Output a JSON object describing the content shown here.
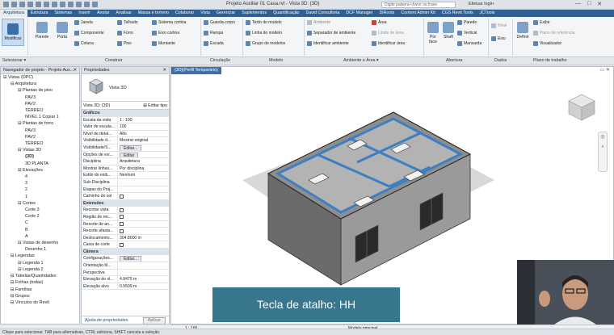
{
  "window": {
    "title": "Projeto Auxiliar 01 Casa.rvt - Vista 3D: {3D}",
    "search_placeholder": "Digite palavra-chave ou frase",
    "user": "Efetuar login",
    "controls": [
      "—",
      "□",
      "✕"
    ]
  },
  "tabs": [
    "Arquitetura",
    "Estrutura",
    "Sistemas",
    "Inserir",
    "Anotar",
    "Analisar",
    "Massa e terreno",
    "Colaborar",
    "Vista",
    "Gerenciar",
    "Suplementos",
    "Quantificação",
    "David Consultoria",
    "DCF Manager",
    "DiRoots",
    "Content Admin Kit",
    "CGS Revit Tools",
    "JCTools"
  ],
  "ribbon": {
    "modify": "Modificar",
    "construir": [
      "Parede",
      "Porta",
      "Janela",
      "Componente",
      "Coluna",
      "Telhado",
      "Forro",
      "Piso",
      "Sistema cortina",
      "Eixo cortina",
      "Montante"
    ],
    "circulacao": [
      "Guarda-corpo",
      "Rampa",
      "Escada"
    ],
    "modelo": [
      "Texto do modelo",
      "Linha do modelo",
      "Grupo de modelos"
    ],
    "ambiente": [
      "Ambiente",
      "Separador de ambiente",
      "Identificar ambiente",
      "Área",
      "Limite de área",
      "Identificar área"
    ],
    "abertura": [
      "Por face",
      "Shaft",
      "Parede",
      "Vertical",
      "Mansarda"
    ],
    "dados": [
      "Nível",
      "Eixo"
    ],
    "plano": [
      "Definir",
      "Exibir",
      "Plano de referência",
      "Visualizador"
    ]
  },
  "group_labels": [
    "Selecionar",
    "Construir",
    "Circulação",
    "Modelo",
    "Ambiente e Área",
    "Abertura",
    "Dados",
    "Plano de trabalho"
  ],
  "options_bar": {
    "select": "Selecionar ▾",
    "construir": "Construir",
    "circulacao": "Circulação",
    "modelo": "Modelo",
    "ambiente": "Ambiente e Área ▾",
    "abertura": "Abertura",
    "dados": "Dados",
    "plano": "Plano de trabalho"
  },
  "project_browser": {
    "title": "Navegador de projeto - Projeto Aux...",
    "items": [
      "Vistas (DPC)",
      "Arquitetura",
      "Plantas de piso",
      "PAV3",
      "PAV2",
      "TÉRREO",
      "NIVEL 1 Copiar 1",
      "Plantas de forro",
      "PAV3",
      "PAV2",
      "TÉRREO",
      "Vistas 3D",
      "{3D}",
      "3D PLANTA",
      "Elevações",
      "4",
      "3",
      "2",
      "1",
      "Cortes",
      "Corte 3",
      "Corte 2",
      "C",
      "B",
      "A",
      "Vistas de desenho",
      "Desenho 1",
      "Legendas",
      "Legenda 1",
      "Legenda 2",
      "Tabelas/Quantidades",
      "Folhas (todas)",
      "Famílias",
      "Grupos",
      "Vínculos do Revit"
    ]
  },
  "properties": {
    "title": "Propriedades",
    "type_name": "Vista 3D",
    "type_selector": "Vista 3D: {3D}",
    "edit_type": "Editar tipo",
    "rows": [
      {
        "k": "Gráficos",
        "section": true
      },
      {
        "k": "Escala da vista",
        "v": "1 : 100"
      },
      {
        "k": "Valor de escala...",
        "v": "100"
      },
      {
        "k": "Nível de detal...",
        "v": "Alto"
      },
      {
        "k": "Visibilidade d...",
        "v": "Mostrar original"
      },
      {
        "k": "Visibilidade/S...",
        "v": "Editar...",
        "btn": true
      },
      {
        "k": "Opções de exi...",
        "v": "Editar",
        "btn": true
      },
      {
        "k": "Disciplina",
        "v": "Arquitetura"
      },
      {
        "k": "Mostrar linhas...",
        "v": "Por disciplina"
      },
      {
        "k": "Estilo do exib...",
        "v": "Nenhum"
      },
      {
        "k": "Sub-Disciplina",
        "v": ""
      },
      {
        "k": "Etapas do Proj...",
        "v": ""
      },
      {
        "k": "Caminho do sol",
        "v": "",
        "chk": true
      },
      {
        "k": "Extensões",
        "section": true
      },
      {
        "k": "Recortar vista",
        "v": "",
        "chk": true
      },
      {
        "k": "Região de rec...",
        "v": "",
        "chk": true
      },
      {
        "k": "Recorte de an...",
        "v": "",
        "chk": true
      },
      {
        "k": "Recorte afasta...",
        "v": "",
        "chk": true
      },
      {
        "k": "Deslocamento...",
        "v": "304.8000 m"
      },
      {
        "k": "Caixa de corte",
        "v": "",
        "chk": true
      },
      {
        "k": "Câmera",
        "section": true
      },
      {
        "k": "Configurações...",
        "v": "Editar...",
        "btn": true
      },
      {
        "k": "Orientação bl...",
        "v": ""
      },
      {
        "k": "Perspectiva",
        "v": ""
      },
      {
        "k": "Elevação do ol...",
        "v": "4.8475 m"
      },
      {
        "k": "Elevação alvo",
        "v": "0.5509 m"
      }
    ],
    "help_link": "Ajuda de propriedades",
    "apply": "Aplicar"
  },
  "viewport": {
    "tab": "{3D}(Perfil Temporário)",
    "scale": "1 : 100",
    "model": "Modelo principal"
  },
  "caption": "Tecla de atalho: HH",
  "status": "Clique para selecionar, TAB para alternativas, CTRL adiciona, SHIFT cancela a seleção."
}
